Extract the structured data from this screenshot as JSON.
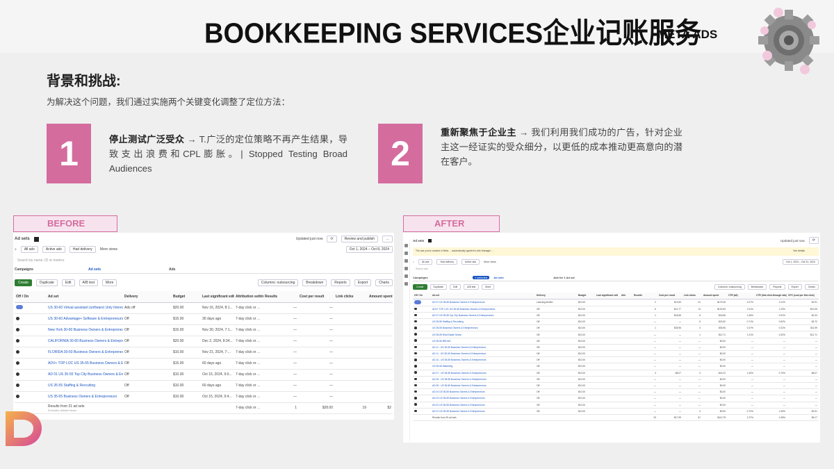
{
  "header": {
    "title": "BOOKKEEPING SERVICES企业记账服务",
    "tag": "META ADS"
  },
  "section": {
    "heading": "背景和挑战:",
    "intro": "为解决这个问题，我们通过实施两个关键变化调整了定位方法："
  },
  "points": [
    {
      "number": "1",
      "bold": "停止测试广泛受众",
      "text": " → T.广泛的定位策略不再产生结果，导致支出浪费和CPL膨胀。| Stopped Testing Broad Audiences"
    },
    {
      "number": "2",
      "bold": "重新聚焦于企业主",
      "text": " → 我们利用我们成功的广告，针对企业主这一经证实的受众细分，以更低的成本推动更高意向的潜在客户。"
    }
  ],
  "labels": {
    "before": "BEFORE",
    "after": "AFTER"
  },
  "before": {
    "page_title": "Ad sets",
    "updated": "Updated just now",
    "review_button": "Review and publish",
    "filters": [
      "All ads",
      "Active ads",
      "Had delivery",
      "More views"
    ],
    "date_range": "Oct 1, 2024 – Oct 8, 2024",
    "search_placeholder": "Search by name, ID or metrics",
    "tabs": [
      "Campaigns",
      "Ad sets",
      "Ads"
    ],
    "toolbar": [
      "Create",
      "Duplicate",
      "Edit",
      "A/B test",
      "More",
      "Columns: outsourcing",
      "Breakdown",
      "Reports",
      "Export",
      "Charts"
    ],
    "columns": [
      "Off / On",
      "Ad set",
      "Delivery",
      "Budget",
      "Last significant edit",
      "Attribution setting",
      "Results",
      "Cost per result",
      "Link clicks",
      "Amount spent"
    ],
    "rows": [
      {
        "name": "US 30-60 Virtual assistant (software) Unly Interest",
        "delivery": "Ads off",
        "budget": "$20.00",
        "edit": "Nov 16, 2024, 8:1...",
        "attr": "7-day click or ...",
        "results": "—",
        "cpr": "—",
        "on": true
      },
      {
        "name": "US 30-60 Advantage+ Software & Entrepreneurs",
        "delivery": "Off",
        "budget": "$15.00",
        "edit": "30 days ago",
        "attr": "7-day click or ...",
        "results": "—",
        "cpr": "—",
        "on": false
      },
      {
        "name": "New York 30-60 Business Owners & Entrepreneurs",
        "delivery": "Off",
        "budget": "$15.00",
        "edit": "Nov 30, 2024, 7:1...",
        "attr": "7-day click or ...",
        "results": "—",
        "cpr": "—",
        "on": false
      },
      {
        "name": "CALIFORNIA 30-60 Business Owners & Entrepreneurs",
        "delivery": "Off",
        "budget": "$20.00",
        "edit": "Dec 2, 2024, 8:34...",
        "attr": "7-day click or ...",
        "results": "—",
        "cpr": "—",
        "on": false
      },
      {
        "name": "FLORIDA 30-60 Business Owners & Entrepreneurs",
        "delivery": "Off",
        "budget": "$10.00",
        "edit": "Nov 21, 2024, 7:...",
        "attr": "7-day click or ...",
        "results": "—",
        "cpr": "—",
        "on": false
      },
      {
        "name": "ADV+ TOP LOC US 35-55 Business Owners & Entrepreneurs",
        "delivery": "Off",
        "budget": "$15.00",
        "edit": "60 days ago",
        "attr": "7-day click or ...",
        "results": "—",
        "cpr": "—",
        "on": false
      },
      {
        "name": "AD 01 US 35-55 Top City Business Owners & Entrepreneurs",
        "delivery": "Off",
        "budget": "$10.00",
        "edit": "Oct 15, 2024, 9:0...",
        "attr": "7-day click or ...",
        "results": "—",
        "cpr": "—",
        "on": false
      },
      {
        "name": "US 35-55 Staffing & Recruiting",
        "delivery": "Off",
        "budget": "$10.00",
        "edit": "60 days ago",
        "attr": "7-day click or ...",
        "results": "—",
        "cpr": "—",
        "on": false
      },
      {
        "name": "US 35-55 Business Owners & Entrepreneurs",
        "delivery": "Off",
        "budget": "$10.00",
        "edit": "Oct 15, 2024, 9:4...",
        "attr": "7-day click or ...",
        "results": "—",
        "cpr": "—",
        "on": false
      }
    ],
    "footer": {
      "label": "Results from 21 ad sets",
      "sub": "Excludes deleted items",
      "attr": "7-day click or ...",
      "results": "1",
      "cpr": "$28.00",
      "clicks": "19",
      "spent": "$2"
    }
  },
  "after": {
    "page_title": "Ad sets",
    "updated": "Updated just now",
    "notice": "The ads you've created in Meta ... automatically applied to Ads Manager ...",
    "notice_action": "See details",
    "filters": [
      "All ads",
      "Had delivery",
      "Active ads",
      "More views"
    ],
    "date_range": "Oct 1, 2024 – Oct 31, 2024",
    "search_placeholder": "Search ads",
    "tabs": [
      "Campaigns",
      "Ad sets",
      "Ads for 1 Ad set"
    ],
    "selected": "1 selected",
    "toolbar": [
      "Create",
      "Duplicate",
      "Edit",
      "A/B test",
      "More",
      "Columns: outsourcing",
      "Breakdown",
      "Reports",
      "Export",
      "Charts"
    ],
    "columns": [
      "Off / On",
      "Ad set",
      "Delivery",
      "Budget",
      "Last significant edit",
      "Attr.",
      "Results",
      "Cost per result",
      "Link clicks",
      "Amount spent",
      "CTR (all)",
      "CTR (link click-through rate)",
      "CPC (cost per link click)"
    ],
    "rows": [
      {
        "name": "AD 07 US 35-65 Business Owners & Entrepreneurs",
        "delivery": "Learning limited",
        "budget": "$10.00",
        "results": "2",
        "cpr": "$13.83",
        "clicks": "31",
        "spent": "$176.45",
        "ctr": "2.07%",
        "lctr": "1.01%",
        "cpc": "$2.91",
        "on": true
      },
      {
        "name": "ADV+ TOP LOC US 35-55 Business Owners & Entrepreneurs",
        "delivery": "Off",
        "budget": "$10.00",
        "results": "6",
        "cpr": "$21.77",
        "clicks": "13",
        "spent": "$130.63",
        "ctr": "1.91%",
        "lctr": "1.23%",
        "cpc": "$10.05",
        "on": false
      },
      {
        "name": "AD 07 US 35-55 Top City Business Owners & Entrepreneurs",
        "delivery": "Off",
        "budget": "$10.00",
        "results": "1",
        "cpr": "$18.65",
        "clicks": "8",
        "spent": "$18.65",
        "ctr": "1.46%",
        "lctr": "0.91%",
        "cpc": "$2.33",
        "on": false
      },
      {
        "name": "US 35-55 Staffing & Recruiting",
        "delivery": "Off",
        "budget": "$10.00",
        "results": "—",
        "cpr": "—",
        "clicks": "5",
        "spent": "$23.62",
        "ctr": "0.71%",
        "lctr": "0.52%",
        "cpc": "$4.72",
        "on": false
      },
      {
        "name": "US 35-55 Business Owners & Entrepreneurs",
        "delivery": "Off",
        "budget": "$10.00",
        "results": "1",
        "cpr": "$35.96",
        "clicks": "3",
        "spent": "$35.96",
        "ctr": "0.47%",
        "lctr": "0.31%",
        "cpc": "$11.99",
        "on": false
      },
      {
        "name": "US 35-55 Real Estate Sector",
        "delivery": "Off",
        "budget": "$10.00",
        "results": "—",
        "cpr": "—",
        "clicks": "1",
        "spent": "$12.71",
        "ctr": "1.21%",
        "lctr": "0.32%",
        "cpc": "$12.71",
        "on": false
      },
      {
        "name": "US 35-55 BROAD",
        "delivery": "Off",
        "budget": "$10.00",
        "results": "—",
        "cpr": "—",
        "clicks": "—",
        "spent": "$0.00",
        "ctr": "—",
        "lctr": "—",
        "cpc": "—",
        "on": false
      },
      {
        "name": "AD 11 - US 35-65 Business Owners & Entrepreneurs",
        "delivery": "Off",
        "budget": "$10.00",
        "results": "—",
        "cpr": "—",
        "clicks": "—",
        "spent": "$0.00",
        "ctr": "—",
        "lctr": "—",
        "cpc": "—",
        "on": false
      },
      {
        "name": "AD 11 - US 35-65 Business Owners & Entrepreneurs",
        "delivery": "Off",
        "budget": "$10.00",
        "results": "—",
        "cpr": "—",
        "clicks": "—",
        "spent": "$0.00",
        "ctr": "—",
        "lctr": "—",
        "cpc": "—",
        "on": false
      },
      {
        "name": "AD 10 - US 35-65 Business Owners & Entrepreneurs",
        "delivery": "Off",
        "budget": "$10.00",
        "results": "—",
        "cpr": "—",
        "clicks": "—",
        "spent": "$0.00",
        "ctr": "—",
        "lctr": "—",
        "cpc": "—",
        "on": false
      },
      {
        "name": "US 35-55 Marketing",
        "delivery": "Off",
        "budget": "$10.00",
        "results": "—",
        "cpr": "—",
        "clicks": "—",
        "spent": "$0.00",
        "ctr": "—",
        "lctr": "—",
        "cpc": "—",
        "on": false
      },
      {
        "name": "AD 07 - US 35-65 Business Owners & Entrepreneurs",
        "delivery": "Off",
        "budget": "$10.00",
        "results": "3",
        "cpr": "$8.07",
        "clicks": "3",
        "spent": "$24.22",
        "ctr": "1.40%",
        "lctr": "0.70%",
        "cpc": "$8.07",
        "on": false
      },
      {
        "name": "AD 06 - US 35-65 Business Owners & Entrepreneurs",
        "delivery": "Off",
        "budget": "$10.00",
        "results": "—",
        "cpr": "—",
        "clicks": "—",
        "spent": "$0.00",
        "ctr": "—",
        "lctr": "—",
        "cpc": "—",
        "on": false
      },
      {
        "name": "AD 05 - US 35-65 Business Owners & Entrepreneurs",
        "delivery": "Off",
        "budget": "$10.00",
        "results": "—",
        "cpr": "—",
        "clicks": "—",
        "spent": "$0.00",
        "ctr": "—",
        "lctr": "—",
        "cpc": "—",
        "on": false
      },
      {
        "name": "AD 04 US 35-55 Business Owners & Entrepreneurs",
        "delivery": "Off",
        "budget": "$10.00",
        "results": "—",
        "cpr": "—",
        "clicks": "—",
        "spent": "$0.00",
        "ctr": "—",
        "lctr": "—",
        "cpc": "—",
        "on": false
      },
      {
        "name": "AD 03 US 35-55 Business Owners & Entrepreneurs",
        "delivery": "Off",
        "budget": "$10.00",
        "results": "—",
        "cpr": "—",
        "clicks": "—",
        "spent": "$0.00",
        "ctr": "—",
        "lctr": "—",
        "cpc": "—",
        "on": false
      },
      {
        "name": "AD 02 US 35-55 Business Owners & Entrepreneurs",
        "delivery": "Off",
        "budget": "$10.00",
        "results": "—",
        "cpr": "—",
        "clicks": "—",
        "spent": "$0.00",
        "ctr": "—",
        "lctr": "—",
        "cpc": "—",
        "on": false
      },
      {
        "name": "AD 01 US 35-55 Business Owners & Entrepreneurs",
        "delivery": "Off",
        "budget": "$10.00",
        "results": "—",
        "cpr": "—",
        "clicks": "3",
        "spent": "$9.94",
        "ctr": "0.72%",
        "lctr": "1.05%",
        "cpc": "$3.31",
        "on": false
      }
    ],
    "footer": {
      "label": "Results from 25 ad sets",
      "results": "23",
      "cpr": "$17.99",
      "clicks": "67",
      "spent": "$413.78",
      "ctr": "1.37%",
      "lctr": "1.08%",
      "cpc": "$6.17"
    }
  },
  "colors": {
    "accent": "#d46c9e",
    "tag_bg": "#f7e3ee",
    "link": "#1a56c4"
  }
}
